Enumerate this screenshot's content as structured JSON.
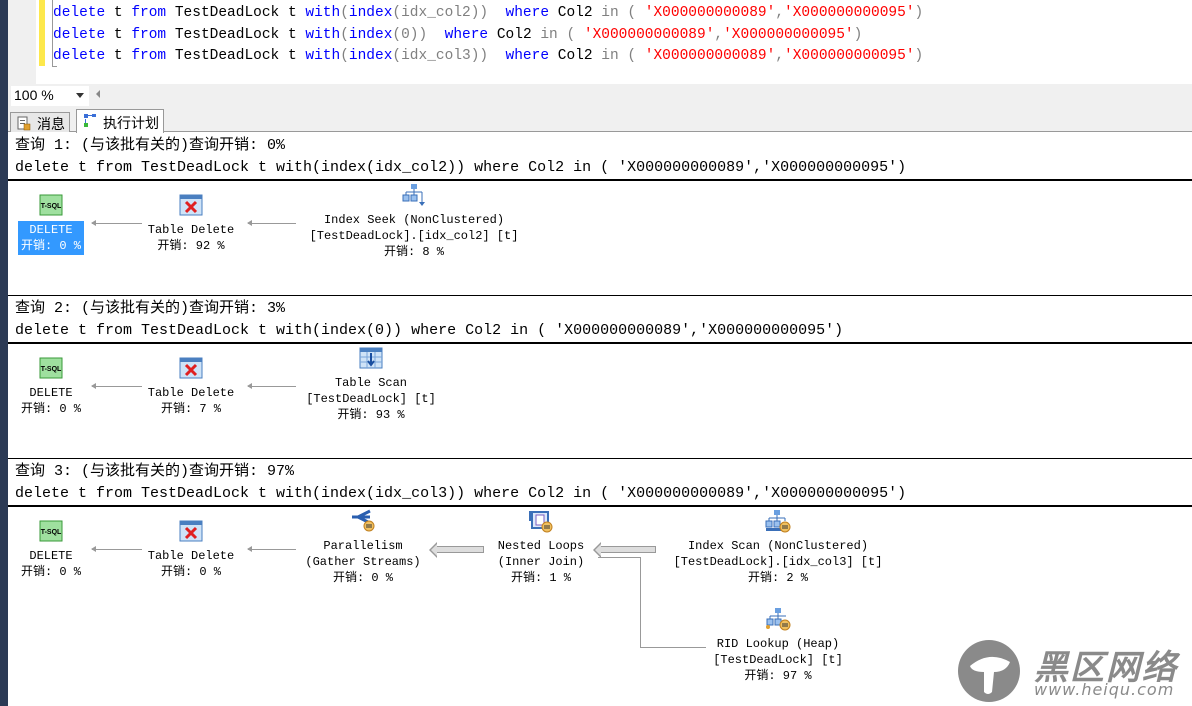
{
  "editor": {
    "lines": [
      {
        "a": "delete",
        "b": " t ",
        "c": "from",
        "d": " TestDeadLock t ",
        "e": "with",
        "f": "(",
        "g": "index",
        "h": "(idx_col2))",
        "i": "  ",
        "j": "where",
        "k": " Col2 ",
        "l": "in",
        "m": " ( ",
        "n": "'X000000000089'",
        "o": ",",
        "p": "'X000000000095'",
        "q": ")"
      },
      {
        "a": "delete",
        "b": " t ",
        "c": "from",
        "d": " TestDeadLock t ",
        "e": "with",
        "f": "(",
        "g": "index",
        "h": "(0))",
        "i": "  ",
        "j": "where",
        "k": " Col2 ",
        "l": "in",
        "m": " ( ",
        "n": "'X000000000089'",
        "o": ",",
        "p": "'X000000000095'",
        "q": ")"
      },
      {
        "a": "delete",
        "b": " t ",
        "c": "from",
        "d": " TestDeadLock t ",
        "e": "with",
        "f": "(",
        "g": "index",
        "h": "(idx_col3))",
        "i": "  ",
        "j": "where",
        "k": " Col2 ",
        "l": "in",
        "m": " ( ",
        "n": "'X000000000089'",
        "o": ",",
        "p": "'X000000000095'",
        "q": ")"
      }
    ]
  },
  "zoom": {
    "value": "100 %"
  },
  "tabs": [
    {
      "label": "消息",
      "icon": "messages-icon"
    },
    {
      "label": "执行计划",
      "icon": "execution-plan-icon"
    }
  ],
  "queries": [
    {
      "header": "查询 1: (与该批有关的)查询开销: 0%",
      "sql": "delete t from TestDeadLock t with(index(idx_col2)) where Col2 in ( 'X000000000089','X000000000095')",
      "nodes": [
        {
          "lines": [
            "DELETE",
            "开销: 0 %"
          ],
          "icon": "tsql-icon"
        },
        {
          "lines": [
            "Table Delete",
            "开销: 92 %"
          ],
          "icon": "table-delete-icon"
        },
        {
          "lines": [
            "Index Seek (NonClustered)",
            "[TestDeadLock].[idx_col2] [t]",
            "开销: 8 %"
          ],
          "icon": "index-seek-icon"
        }
      ]
    },
    {
      "header": "查询 2: (与该批有关的)查询开销: 3%",
      "sql": "delete t from TestDeadLock t with(index(0)) where Col2 in ( 'X000000000089','X000000000095')",
      "nodes": [
        {
          "lines": [
            "DELETE",
            "开销: 0 %"
          ],
          "icon": "tsql-icon"
        },
        {
          "lines": [
            "Table Delete",
            "开销: 7 %"
          ],
          "icon": "table-delete-icon"
        },
        {
          "lines": [
            "Table Scan",
            "[TestDeadLock] [t]",
            "开销: 93 %"
          ],
          "icon": "table-scan-icon"
        }
      ]
    },
    {
      "header": "查询 3: (与该批有关的)查询开销: 97%",
      "sql": "delete t from TestDeadLock t with(index(idx_col3)) where Col2 in ( 'X000000000089','X000000000095')",
      "nodes": [
        {
          "lines": [
            "DELETE",
            "开销: 0 %"
          ],
          "icon": "tsql-icon"
        },
        {
          "lines": [
            "Table Delete",
            "开销: 0 %"
          ],
          "icon": "table-delete-icon"
        },
        {
          "lines": [
            "Parallelism",
            "(Gather Streams)",
            "开销: 0 %"
          ],
          "icon": "parallelism-icon"
        },
        {
          "lines": [
            "Nested Loops",
            "(Inner Join)",
            "开销: 1 %"
          ],
          "icon": "nested-loops-icon"
        },
        {
          "lines": [
            "Index Scan (NonClustered)",
            "[TestDeadLock].[idx_col3] [t]",
            "开销: 2 %"
          ],
          "icon": "index-scan-icon"
        },
        {
          "lines": [
            "RID Lookup (Heap)",
            "[TestDeadLock] [t]",
            "开销: 97 %"
          ],
          "icon": "rid-lookup-icon"
        }
      ]
    }
  ],
  "watermark": {
    "title": "黑区网络",
    "url": "www.heiqu.com"
  }
}
